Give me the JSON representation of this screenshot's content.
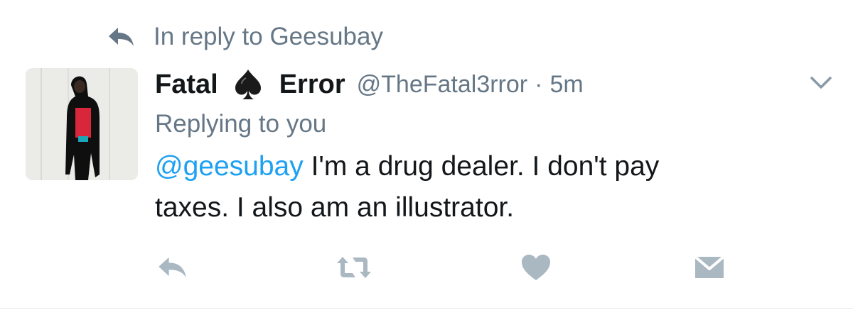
{
  "reply_context": {
    "prefix": "In reply to",
    "target": "Geesubay",
    "icon": "reply-arrow-icon"
  },
  "author": {
    "name_first": "Fatal",
    "name_emoji": "spade",
    "name_last": "Error",
    "handle": "@TheFatal3rror",
    "separator": "·",
    "time": "5m",
    "avatar": "user-avatar-photo"
  },
  "replying_to": "Replying to you",
  "tweet": {
    "mention": "@geesubay",
    "text_line1": " I'm a drug dealer. I don't pay",
    "text_line2": "taxes. I also am an illustrator."
  },
  "actions": [
    {
      "name": "reply",
      "icon": "reply-icon"
    },
    {
      "name": "retweet",
      "icon": "retweet-icon"
    },
    {
      "name": "like",
      "icon": "heart-icon"
    },
    {
      "name": "direct-message",
      "icon": "envelope-icon"
    }
  ],
  "colors": {
    "text": "#14171a",
    "secondary": "#657786",
    "link": "#1da1f2",
    "icon": "#aab8c2"
  }
}
